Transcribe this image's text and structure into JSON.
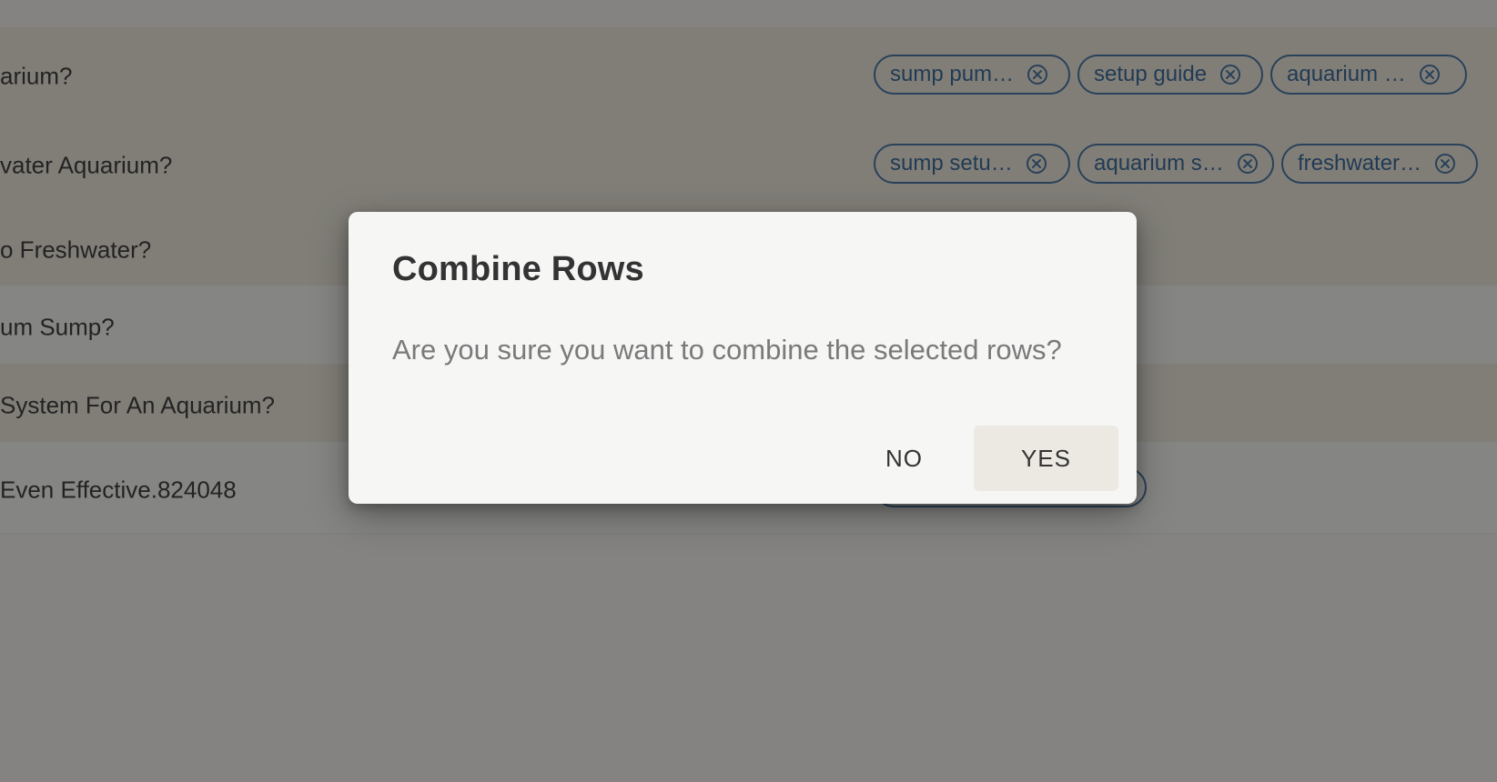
{
  "table": {
    "rows": [
      {
        "title": "arium?",
        "chips": [
          "sump pum…",
          "setup guide",
          "aquarium …"
        ]
      },
      {
        "title": "vater Aquarium?",
        "chips": [
          "sump setu…",
          "aquarium s…",
          "freshwater…"
        ]
      },
      {
        "title": "o Freshwater?",
        "chips": []
      },
      {
        "title": "um Sump?",
        "chips": []
      },
      {
        "title": "System For An Aquarium?",
        "chips": []
      },
      {
        "title": "Even Effective.824048",
        "chips": []
      }
    ]
  },
  "dialog": {
    "title": "Combine Rows",
    "message": "Are you sure you want to combine the selected rows?",
    "no_label": "NO",
    "yes_label": "YES"
  },
  "colors": {
    "chip_border": "#3f6f9f",
    "chip_text": "#2f6294",
    "dialog_bg": "#f6f6f5",
    "overlay": "#141414"
  },
  "icons": {
    "chip_remove": "close-circle-icon"
  }
}
